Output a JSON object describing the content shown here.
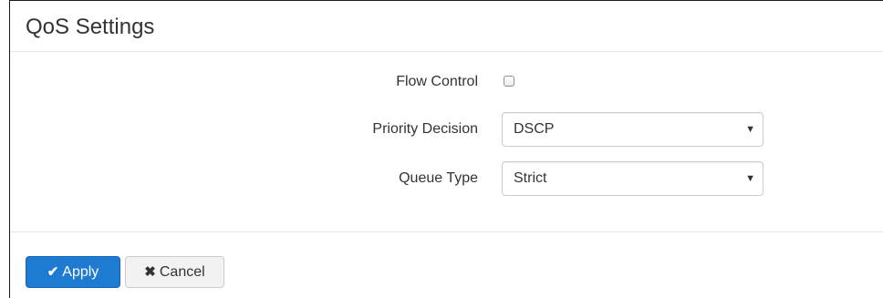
{
  "panel": {
    "title": "QoS Settings"
  },
  "form": {
    "flow_control": {
      "label": "Flow Control",
      "checked": false
    },
    "priority_decision": {
      "label": "Priority Decision",
      "value": "DSCP"
    },
    "queue_type": {
      "label": "Queue Type",
      "value": "Strict"
    }
  },
  "actions": {
    "apply_label": "Apply",
    "apply_icon": "check-icon",
    "cancel_label": "Cancel",
    "cancel_icon": "times-icon"
  },
  "colors": {
    "primary": "#1e7bd1",
    "default_button": "#f2f2f2",
    "divider": "#e5e5e5"
  },
  "icons": {
    "check": "✔",
    "times": "✖",
    "dropdown": "▼"
  }
}
